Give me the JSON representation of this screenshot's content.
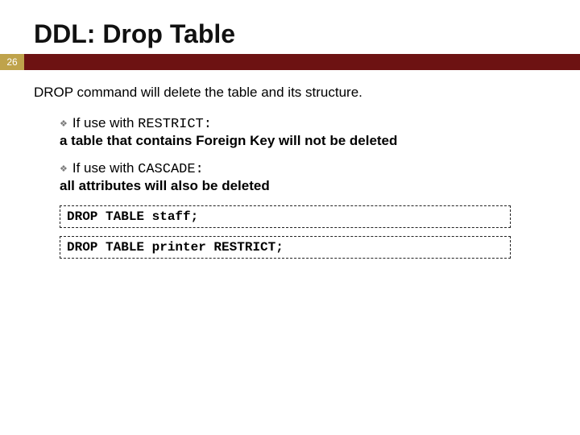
{
  "title": "DDL: Drop Table",
  "page_number": "26",
  "intro": "DROP command will delete the table and its structure.",
  "bullets": [
    {
      "lead": "If use with ",
      "kw": "RESTRICT:",
      "sub": "a table that contains Foreign Key will not be deleted"
    },
    {
      "lead": "If use with ",
      "kw": "CASCADE:",
      "sub": "all attributes will also be deleted"
    }
  ],
  "code": [
    "DROP TABLE staff;",
    "DROP TABLE printer RESTRICT;"
  ]
}
